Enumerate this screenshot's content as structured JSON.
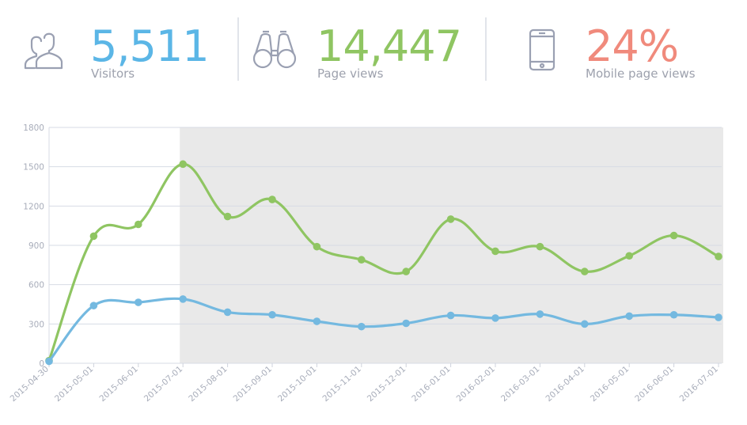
{
  "stats": {
    "visitors": {
      "value": "5,511",
      "label": "Visitors",
      "color": "#5bb6e6",
      "icon": "users-icon"
    },
    "pageviews": {
      "value": "14,447",
      "label": "Page views",
      "color": "#8fc562",
      "icon": "binoculars-icon"
    },
    "mobile": {
      "value": "24%",
      "label": "Mobile page views",
      "color": "#f08a7c",
      "icon": "smartphone-icon"
    }
  },
  "chart_data": {
    "type": "line",
    "title": "",
    "xlabel": "",
    "ylabel": "",
    "categories": [
      "2015-04-30",
      "2015-05-01",
      "2015-06-01",
      "2015-07-01",
      "2015-08-01",
      "2015-09-01",
      "2015-10-01",
      "2015-11-01",
      "2015-12-01",
      "2016-01-01",
      "2016-02-01",
      "2016-03-01",
      "2016-04-01",
      "2016-05-01",
      "2016-06-01",
      "2016-07-01"
    ],
    "yticks": [
      "0",
      "300",
      "600",
      "900",
      "1200",
      "1500",
      "1800"
    ],
    "ylim": [
      0,
      1800
    ],
    "grid": true,
    "shaded_from_category": "2015-07-01",
    "shade_color": "#e9e9e9",
    "series": [
      {
        "color": "#8fc562",
        "values": [
          20,
          970,
          1060,
          1520,
          1120,
          1250,
          890,
          790,
          700,
          1100,
          855,
          890,
          700,
          820,
          975,
          815
        ]
      },
      {
        "color": "#74b9e0",
        "values": [
          15,
          440,
          465,
          490,
          390,
          370,
          320,
          280,
          305,
          365,
          345,
          375,
          300,
          360,
          370,
          350
        ]
      }
    ]
  }
}
